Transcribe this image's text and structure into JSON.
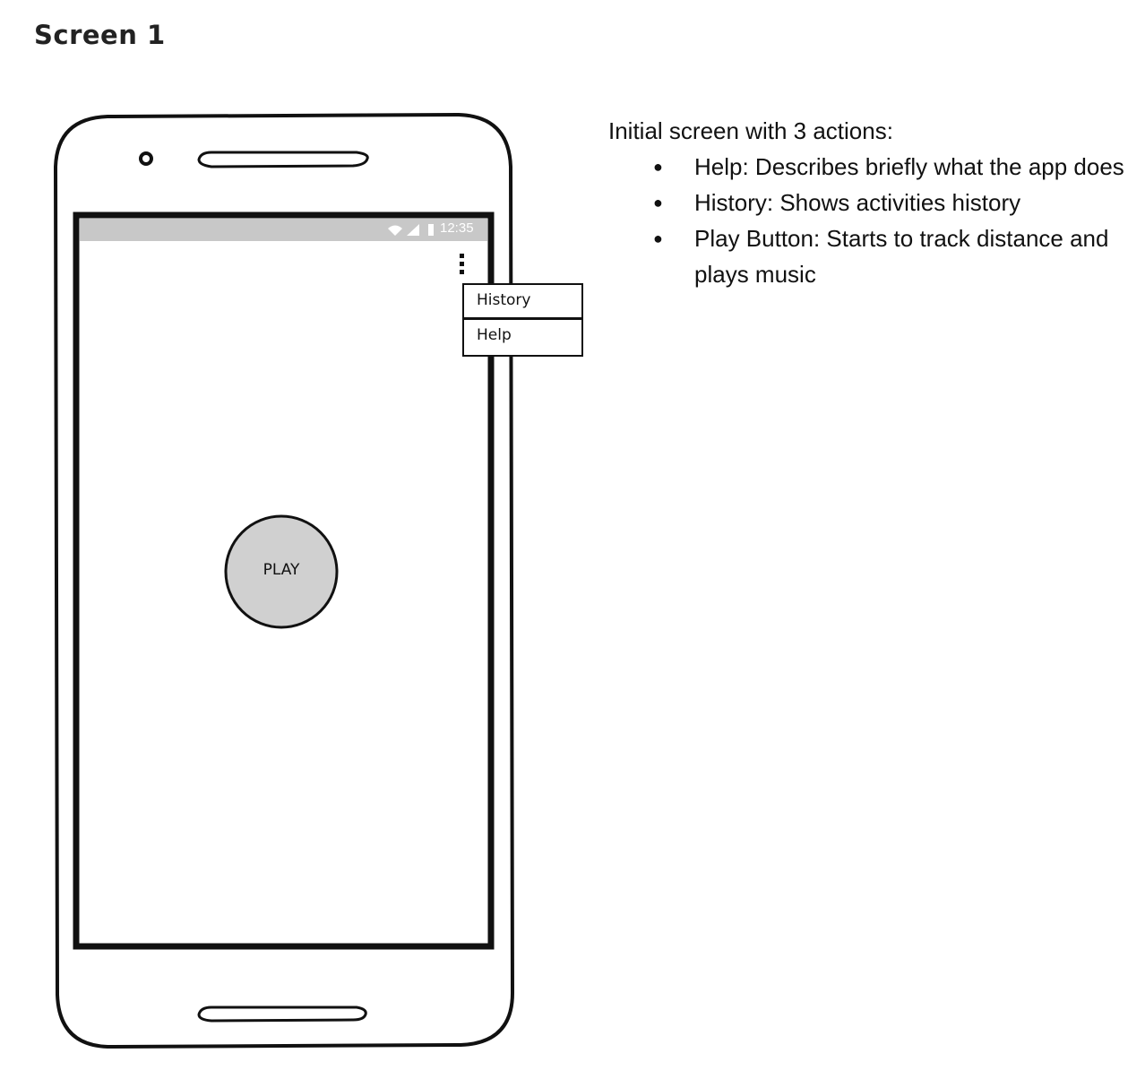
{
  "page": {
    "title": "Screen 1"
  },
  "phone": {
    "status_bar": {
      "time": "12:35"
    },
    "overflow_menu": {
      "items": [
        {
          "label": "History"
        },
        {
          "label": "Help"
        }
      ]
    },
    "play_button": {
      "label": "PLAY"
    }
  },
  "description": {
    "intro": "Initial screen with 3 actions:",
    "bullets": [
      {
        "text": "Help: Describes briefly what the app does"
      },
      {
        "text": "History: Shows activities history"
      },
      {
        "text": "Play Button: Starts to track distance and plays music"
      }
    ]
  },
  "colors": {
    "status_bar": "#c8c8c8",
    "play_button_fill": "#d0d0d0",
    "outline": "#111111"
  }
}
